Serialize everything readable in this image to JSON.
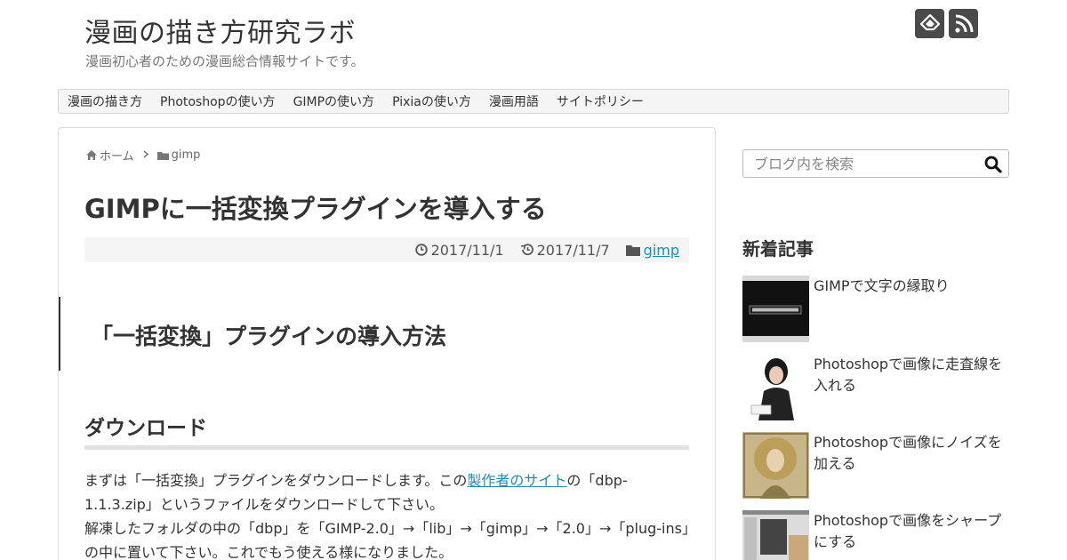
{
  "header": {
    "site_title": "漫画の描き方研究ラボ",
    "site_description": "漫画初心者のための漫画総合情報サイトです。"
  },
  "nav": {
    "items": [
      "漫画の描き方",
      "Photoshopの使い方",
      "GIMPの使い方",
      "Pixiaの使い方",
      "漫画用語",
      "サイトポリシー"
    ]
  },
  "breadcrumb": {
    "home": "ホーム",
    "category": "gimp"
  },
  "article": {
    "title": "GIMPに一括変換プラグインを導入する",
    "published": "2017/11/1",
    "updated": "2017/11/7",
    "category": "gimp",
    "h2": "「一括変換」プラグインの導入方法",
    "h3": "ダウンロード",
    "p1_before": "まずは「一括変換」プラグインをダウンロードします。この",
    "p1_link": "製作者のサイト",
    "p1_after": "の「dbp-1.1.3.zip」というファイルをダウンロードして下さい。",
    "p2": "解凍したフォルダの中の「dbp」を「GIMP-2.0」→「lib」→「gimp」→「2.0」→「plug-ins」の中に置いて下さい。これでもう使える様になりました。"
  },
  "sidebar": {
    "search_placeholder": "ブログ内を検索",
    "recent_heading": "新着記事",
    "recent": [
      {
        "title": "GIMPで文字の縁取り"
      },
      {
        "title": "Photoshopで画像に走査線を入れる"
      },
      {
        "title": "Photoshopで画像にノイズを加える"
      },
      {
        "title": "Photoshopで画像をシャープにする"
      }
    ]
  },
  "colors": {
    "link": "#1a8fb5",
    "icon_bg": "#4a4a4a",
    "text": "#333333"
  }
}
